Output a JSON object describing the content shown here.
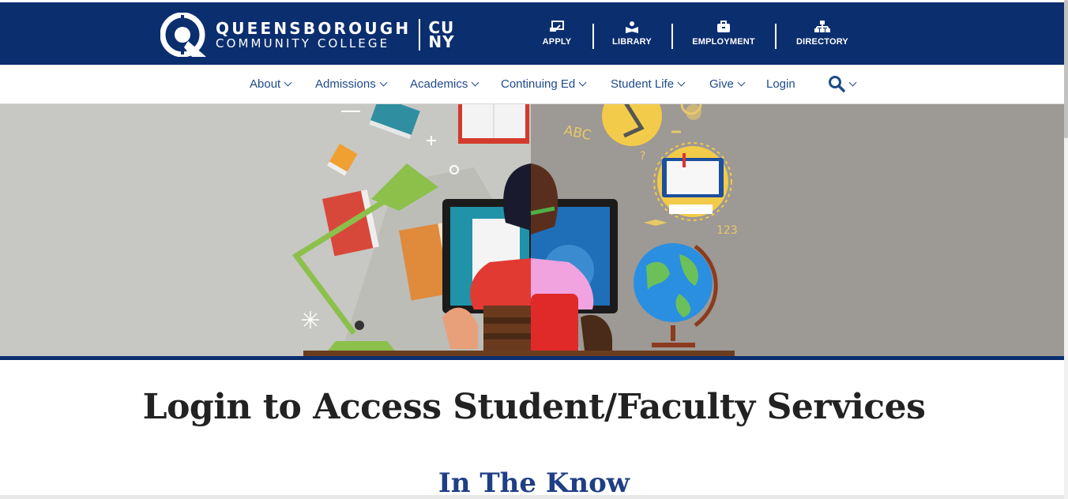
{
  "header": {
    "logo": {
      "line1": "QUEENSBOROUGH",
      "line2": "COMMUNITY COLLEGE",
      "cuny_top": "CU",
      "cuny_bottom": "NY"
    },
    "quick_links": [
      {
        "label": "APPLY",
        "icon": "apply-icon"
      },
      {
        "label": "LIBRARY",
        "icon": "library-icon"
      },
      {
        "label": "EMPLOYMENT",
        "icon": "briefcase-icon"
      },
      {
        "label": "DIRECTORY",
        "icon": "sitemap-icon"
      }
    ]
  },
  "nav": {
    "items": [
      {
        "label": "About",
        "dropdown": true
      },
      {
        "label": "Admissions",
        "dropdown": true
      },
      {
        "label": "Academics",
        "dropdown": true
      },
      {
        "label": "Continuing Ed",
        "dropdown": true
      },
      {
        "label": "Student Life",
        "dropdown": true
      },
      {
        "label": "Give",
        "dropdown": true
      },
      {
        "label": "Login",
        "dropdown": false
      }
    ],
    "search_icon": "search-icon"
  },
  "hero": {
    "illustration": "student-at-desk-illustration",
    "decor_text": {
      "abc": "ABC",
      "num": "123",
      "question": "?"
    }
  },
  "main": {
    "title": "Login to Access Student/Faculty Services",
    "section_title": "In The Know"
  },
  "colors": {
    "brand_blue": "#0b2e6f",
    "nav_text": "#1f4a8a",
    "title_text": "#222222"
  }
}
